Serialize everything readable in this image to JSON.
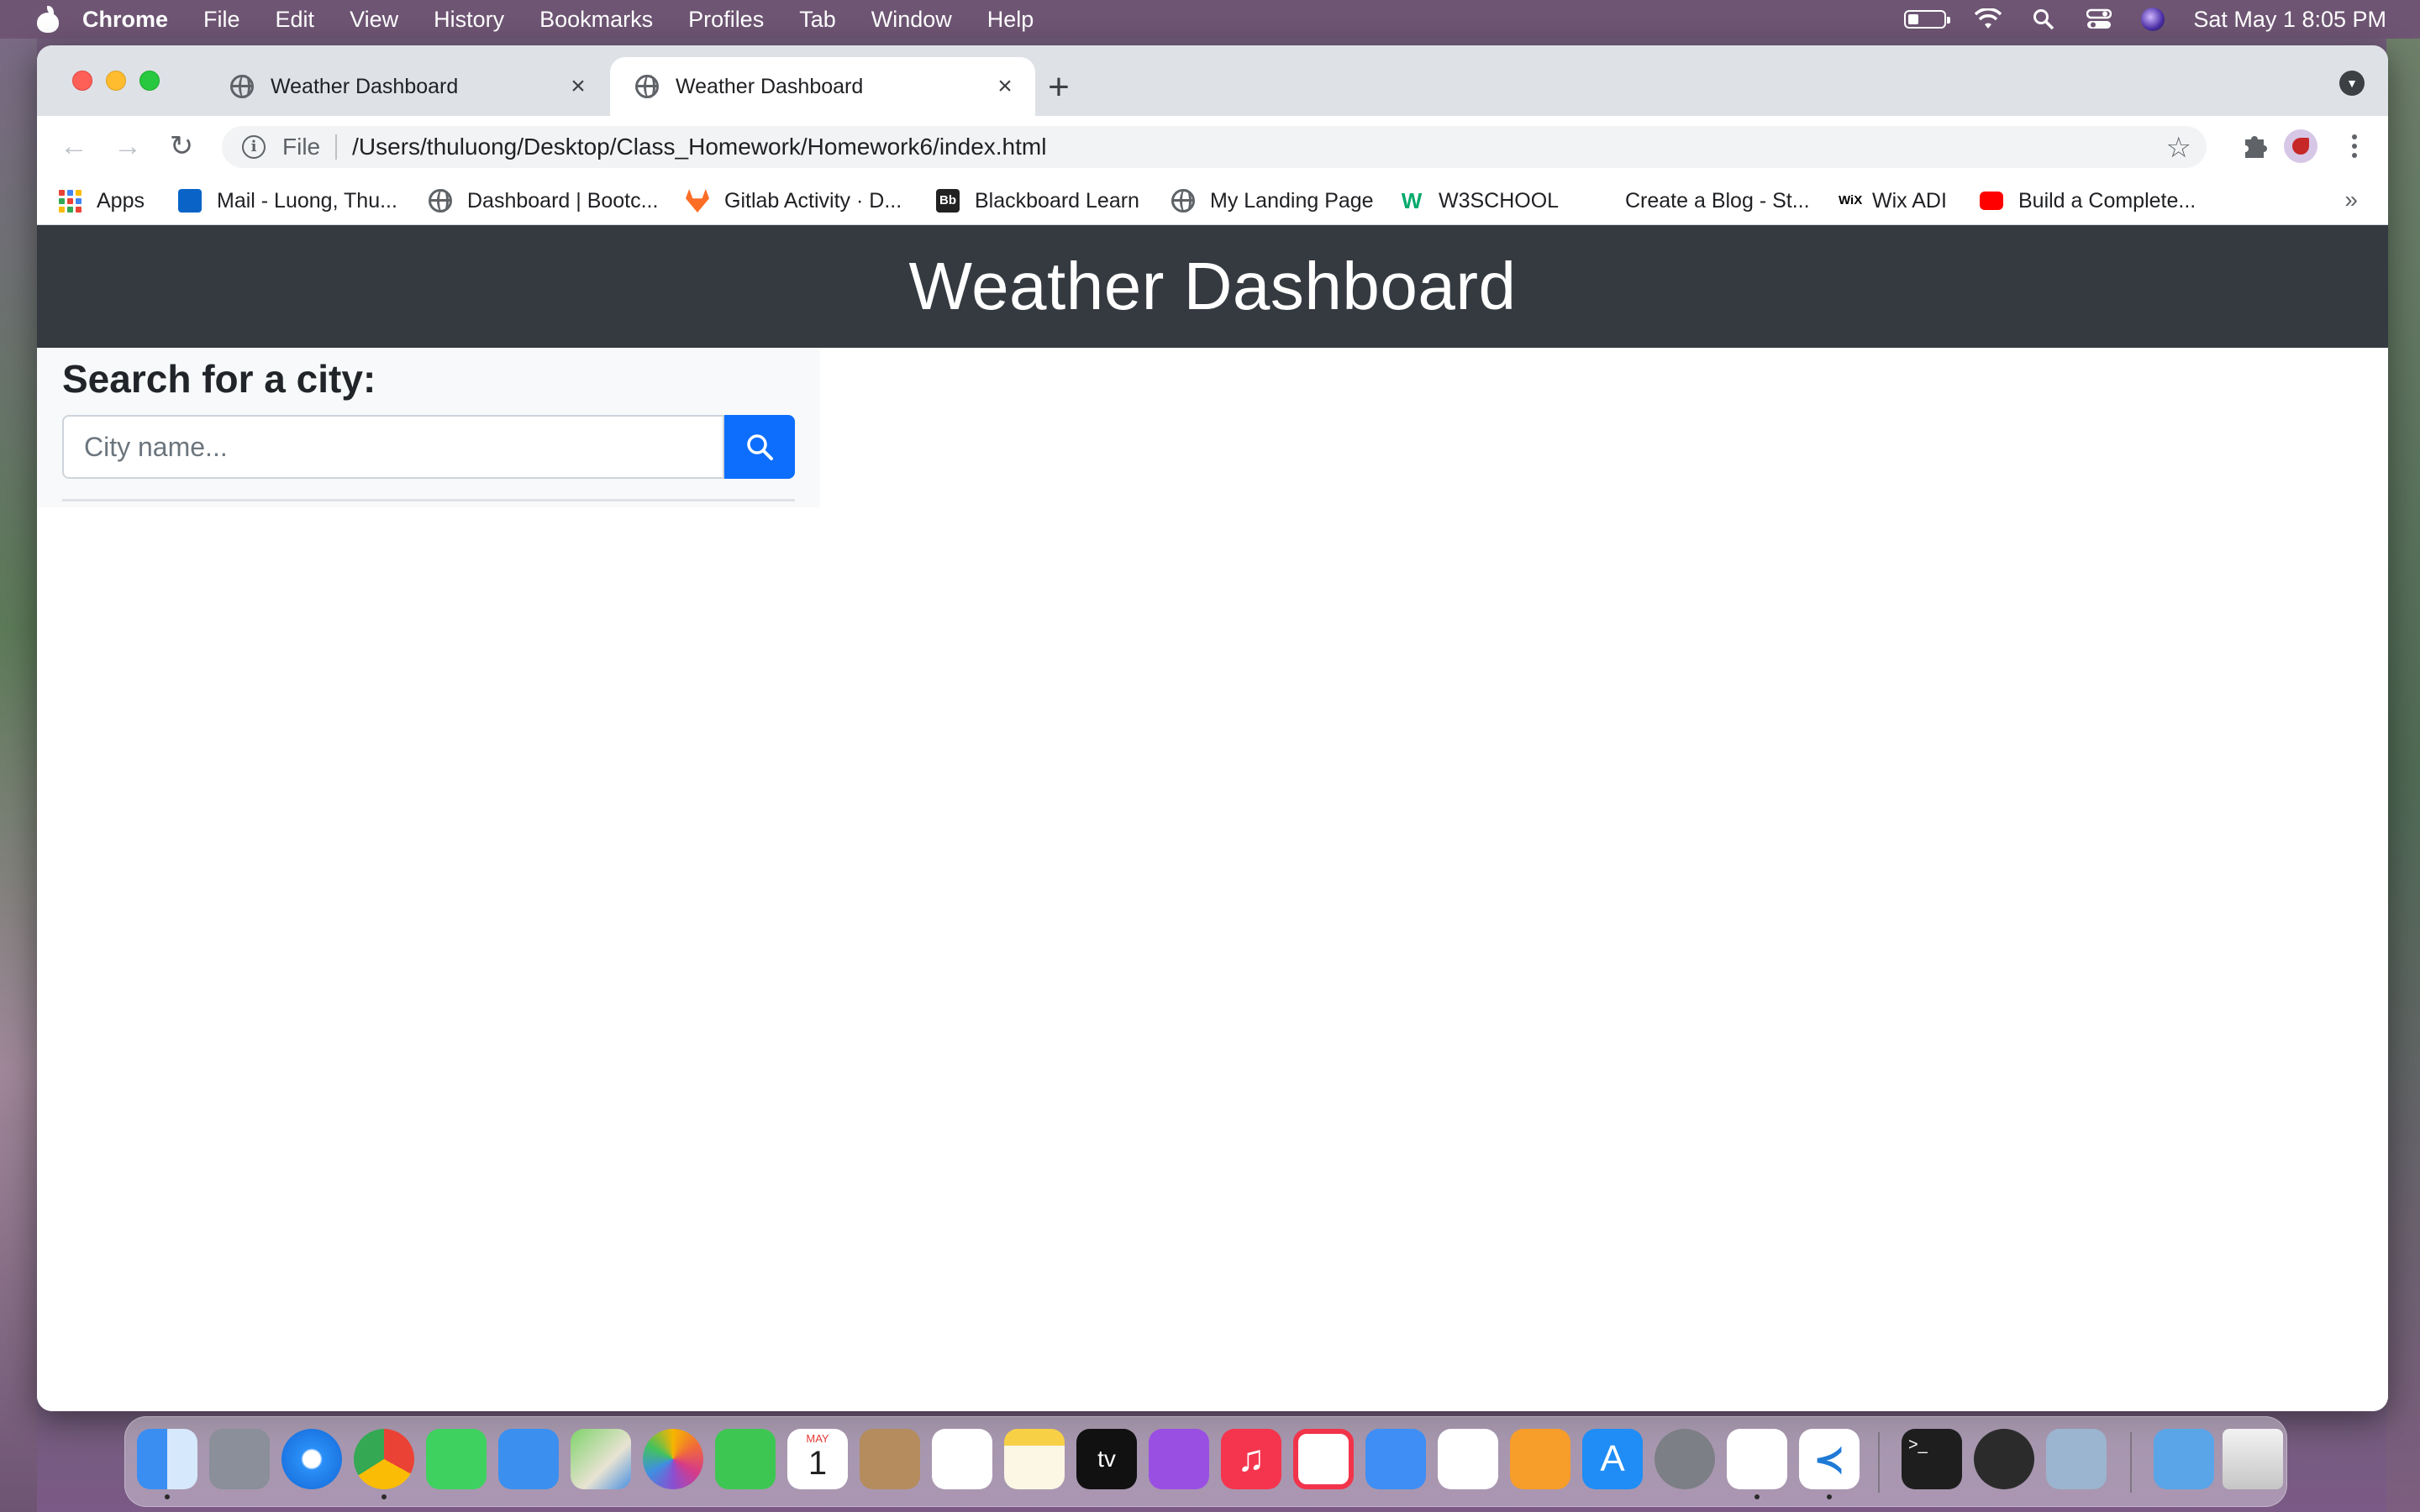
{
  "menubar": {
    "app_name": "Chrome",
    "items": [
      "File",
      "Edit",
      "View",
      "History",
      "Bookmarks",
      "Profiles",
      "Tab",
      "Window",
      "Help"
    ],
    "clock": "Sat May 1  8:05 PM"
  },
  "browser": {
    "tabs": [
      {
        "title": "Weather Dashboard",
        "active": false
      },
      {
        "title": "Weather Dashboard",
        "active": true
      }
    ],
    "address": {
      "scheme_label": "File",
      "url": "/Users/thuluong/Desktop/Class_Homework/Homework6/index.html"
    },
    "bookmarks": [
      {
        "label": "Apps"
      },
      {
        "label": "Mail - Luong, Thu..."
      },
      {
        "label": "Dashboard | Bootc..."
      },
      {
        "label": "Gitlab Activity · D..."
      },
      {
        "label": "Blackboard Learn"
      },
      {
        "label": "My Landing Page"
      },
      {
        "label": "W3SCHOOL"
      },
      {
        "label": "Create a Blog - St..."
      },
      {
        "label": "Wix ADI"
      },
      {
        "label": "Build a Complete..."
      }
    ],
    "bookmarks_overflow": "»"
  },
  "page": {
    "header_title": "Weather Dashboard",
    "search_heading": "Search for a city:",
    "search_placeholder": "City name...",
    "search_value": ""
  },
  "dock": {
    "apps": [
      "finder",
      "launchpad",
      "safari",
      "chrome",
      "messages",
      "mail",
      "maps",
      "photos",
      "facetime",
      "calendar",
      "contacts",
      "reminders",
      "notes",
      "tv",
      "podcasts",
      "music",
      "news",
      "keynote",
      "numbers",
      "pages",
      "app-store",
      "system-preferences",
      "slack",
      "vscode",
      "terminal",
      "quicktime",
      "preview",
      "downloads-folder",
      "trash"
    ],
    "calendar_month": "MAY",
    "calendar_day": "1"
  },
  "colors": {
    "header_bg": "#343a40",
    "sidebar_bg": "#f8f9fa",
    "search_button": "#0d6efd"
  }
}
